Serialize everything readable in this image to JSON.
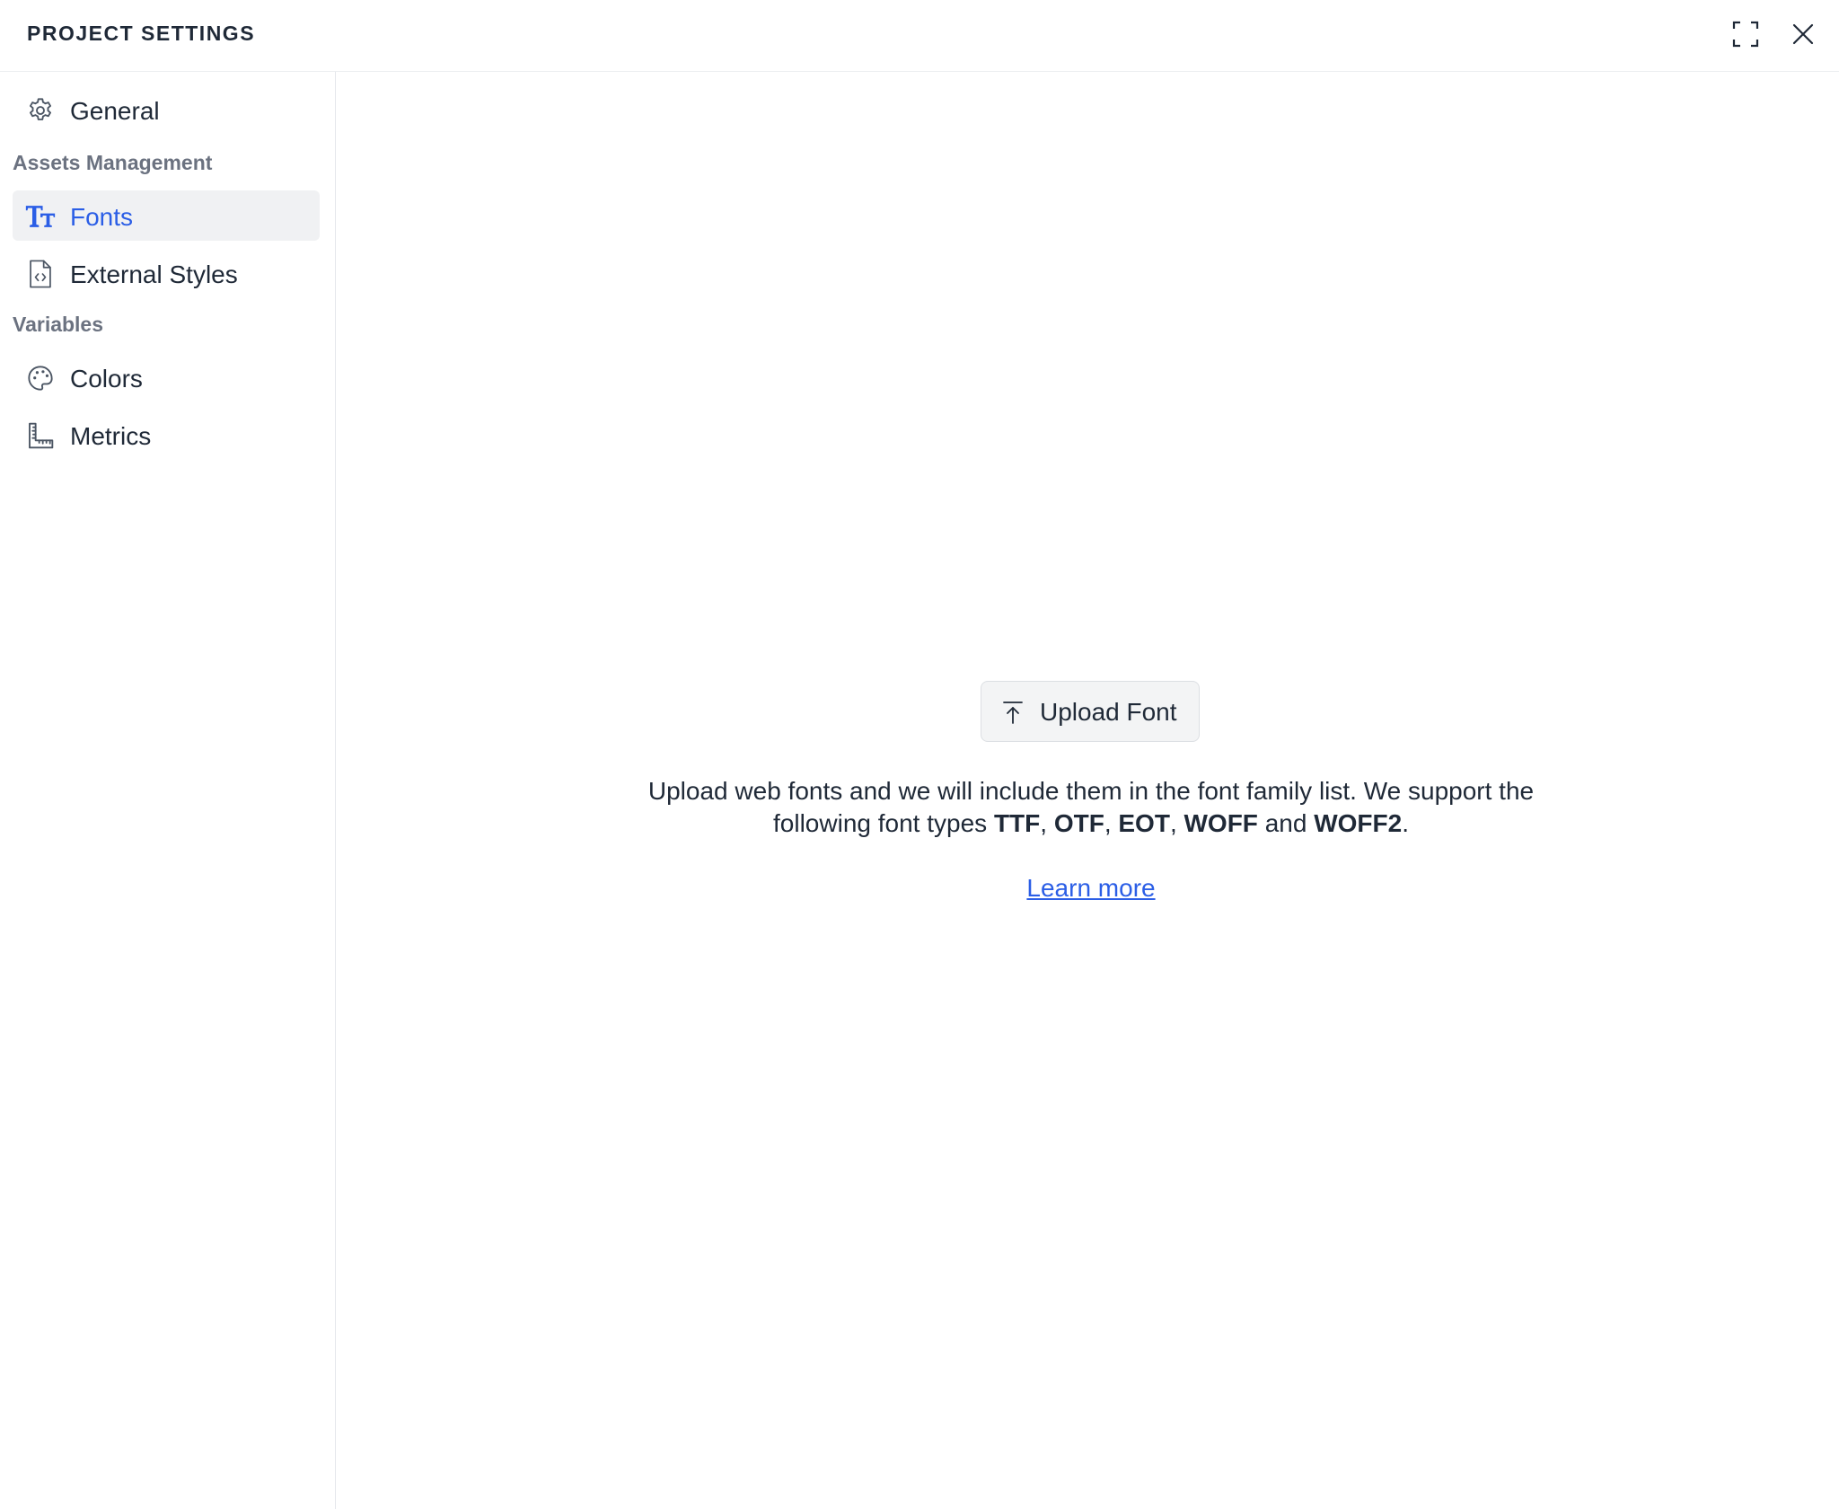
{
  "header": {
    "title": "PROJECT SETTINGS",
    "maximize_icon": "maximize-icon",
    "close_icon": "close-icon"
  },
  "sidebar": {
    "general": {
      "label": "General",
      "icon": "gear-icon"
    },
    "sections": [
      {
        "title": "Assets Management",
        "items": [
          {
            "label": "Fonts",
            "icon": "text-size-icon",
            "active": true
          },
          {
            "label": "External Styles",
            "icon": "code-file-icon",
            "active": false
          }
        ]
      },
      {
        "title": "Variables",
        "items": [
          {
            "label": "Colors",
            "icon": "palette-icon",
            "active": false
          },
          {
            "label": "Metrics",
            "icon": "ruler-icon",
            "active": false
          }
        ]
      }
    ]
  },
  "main": {
    "upload_button": {
      "label": "Upload Font",
      "icon": "upload-icon"
    },
    "description": {
      "prefix": "Upload web fonts and we will include them in the font family list. We support the following font types ",
      "types": [
        "TTF",
        "OTF",
        "EOT",
        "WOFF",
        "WOFF2"
      ],
      "separator": ", ",
      "and": " and ",
      "suffix": "."
    },
    "learn_more": "Learn more"
  },
  "colors": {
    "accent": "#2b5ee6",
    "active_bg": "#f0f1f3",
    "section_label": "#6b7280",
    "text": "#1f2937"
  }
}
